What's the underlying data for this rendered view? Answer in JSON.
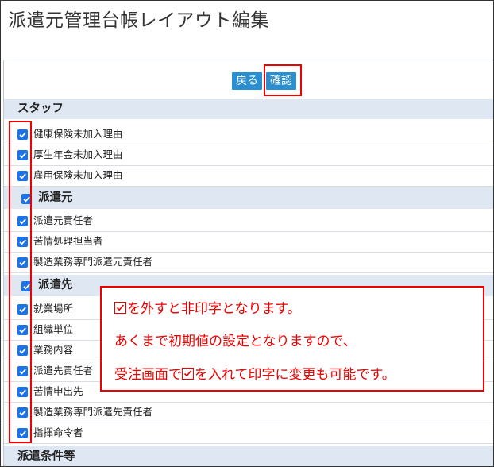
{
  "page": {
    "title": "派遣元管理台帳レイアウト編集"
  },
  "toolbar": {
    "back_label": "戻る",
    "confirm_label": "確認"
  },
  "sections": {
    "staff": {
      "title": "スタッフ",
      "items": [
        "健康保険未加入理由",
        "厚生年金未加入理由",
        "雇用保険未加入理由"
      ]
    },
    "dispatcher": {
      "title": "派遣元",
      "items": [
        "派遣元責任者",
        "苦情処理担当者",
        "製造業務専門派遣元責任者"
      ]
    },
    "destination": {
      "title": "派遣先",
      "items": [
        "就業場所",
        "組織単位",
        "業務内容",
        "派遣先責任者",
        "苦情申出先",
        "製造業務専門派遣先責任者",
        "指揮命令者"
      ]
    },
    "conditions": {
      "title": "派遣条件等"
    }
  },
  "note": {
    "line1": "を外すと非印字となります。",
    "line2": "あくまで初期値の設定となりますので、",
    "line3_before": "受注画面で",
    "line3_after": "を入れて印字に変更も可能です。"
  },
  "colors": {
    "accent": "#2a8fd1",
    "checkbox": "#1a73e8",
    "annotation": "#ee0000",
    "section_bg": "#dfe8f2"
  }
}
